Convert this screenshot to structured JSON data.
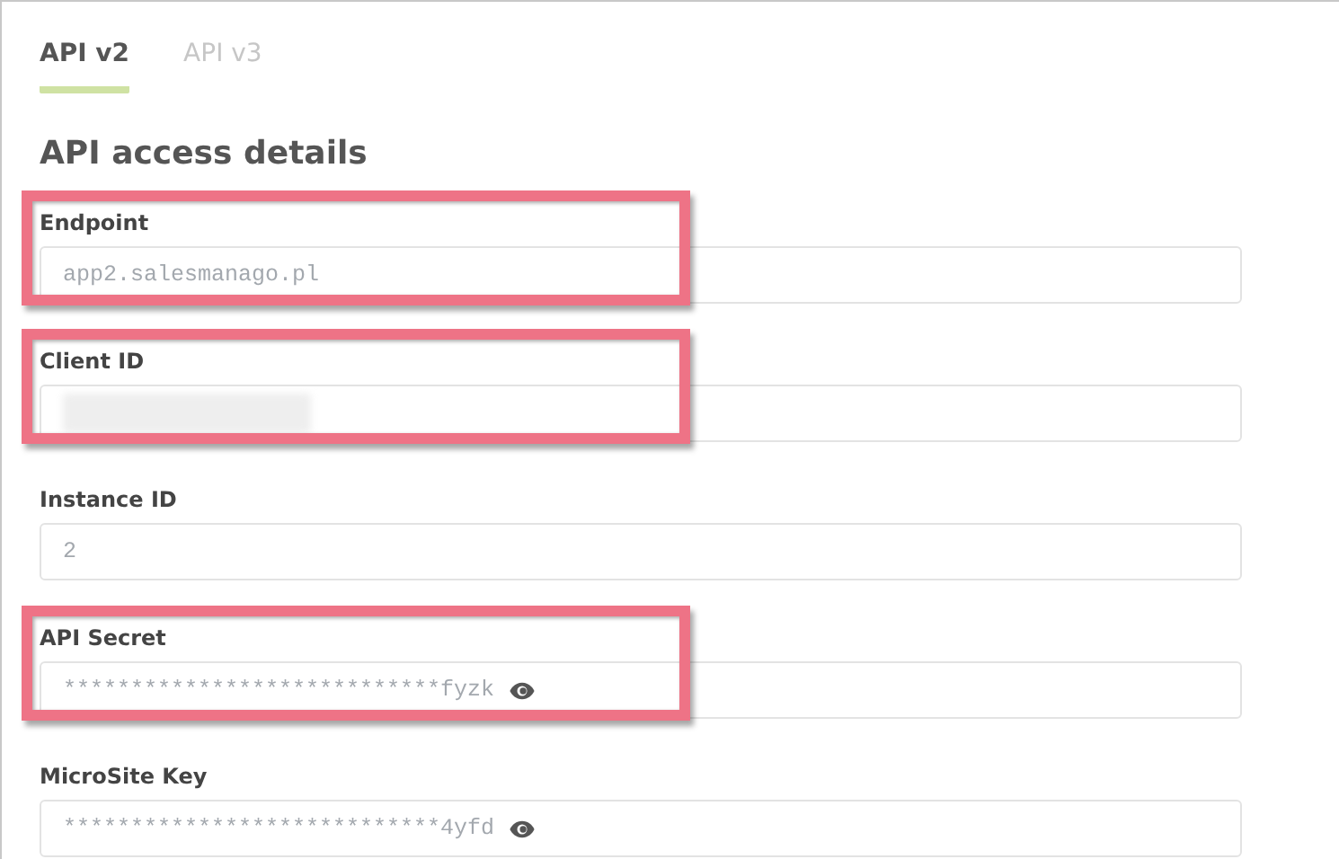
{
  "tabs": [
    {
      "label": "API v2",
      "selected": true
    },
    {
      "label": "API v3",
      "selected": false
    }
  ],
  "heading": "API access details",
  "fields": [
    {
      "kind": "text",
      "label": "Endpoint",
      "value": "app2.salesmanago.pl",
      "highlighted": true
    },
    {
      "kind": "redacted",
      "label": "Client ID",
      "highlighted": true
    },
    {
      "kind": "text",
      "label": "Instance ID",
      "value": "2",
      "highlighted": false
    },
    {
      "kind": "secret",
      "label": "API Secret",
      "value": "****************************fyzk",
      "highlighted": true
    },
    {
      "kind": "secret",
      "label": "MicroSite Key",
      "value": "****************************4yfd",
      "highlighted": false
    }
  ]
}
